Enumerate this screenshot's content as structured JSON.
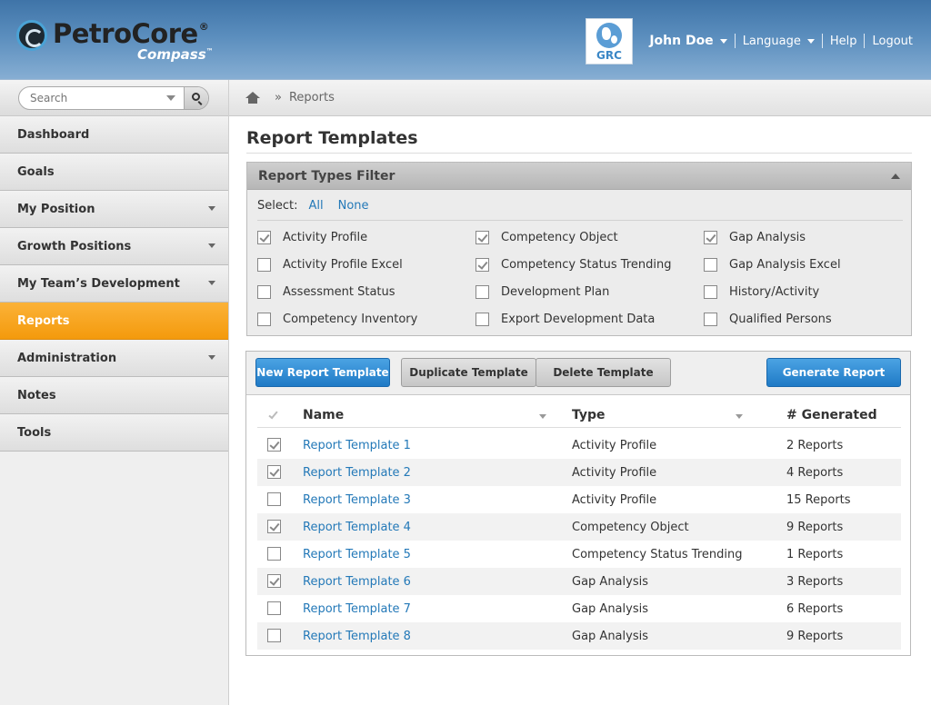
{
  "brand": {
    "name": "PetroCore",
    "reg": "®",
    "sub": "Compass",
    "tm": "™",
    "badge": "GRC"
  },
  "topnav": {
    "user": "John Doe",
    "language": "Language",
    "help": "Help",
    "logout": "Logout"
  },
  "search": {
    "placeholder": "Search"
  },
  "sidebar": {
    "items": [
      {
        "label": "Dashboard"
      },
      {
        "label": "Goals"
      },
      {
        "label": "My Position"
      },
      {
        "label": "Growth Positions"
      },
      {
        "label": "My Team’s Development"
      },
      {
        "label": "Reports"
      },
      {
        "label": "Administration"
      },
      {
        "label": "Notes"
      },
      {
        "label": "Tools"
      }
    ]
  },
  "breadcrumb": {
    "current": "Reports",
    "separator": "»"
  },
  "page": {
    "title": "Report Templates"
  },
  "filter": {
    "title": "Report Types Filter",
    "select_label": "Select:",
    "all": "All",
    "none": "None",
    "options": [
      {
        "label": "Activity Profile",
        "checked": true
      },
      {
        "label": "Activity Profile Excel",
        "checked": false
      },
      {
        "label": "Assessment Status",
        "checked": false
      },
      {
        "label": "Competency Inventory",
        "checked": false
      },
      {
        "label": "Competency Object",
        "checked": true
      },
      {
        "label": "Competency Status Trending",
        "checked": true
      },
      {
        "label": "Development Plan",
        "checked": false
      },
      {
        "label": "Export Development Data",
        "checked": false
      },
      {
        "label": "Gap Analysis",
        "checked": true
      },
      {
        "label": "Gap Analysis Excel",
        "checked": false
      },
      {
        "label": "History/Activity",
        "checked": false
      },
      {
        "label": "Qualified Persons",
        "checked": false
      }
    ]
  },
  "toolbar": {
    "new_label": "New Report Template",
    "duplicate_label": "Duplicate Template",
    "delete_label": "Delete Template",
    "generate_label": "Generate Report"
  },
  "table": {
    "columns": {
      "name": "Name",
      "type": "Type",
      "generated": "# Generated"
    },
    "rows": [
      {
        "name": "Report Template 1",
        "type": "Activity Profile",
        "generated": "2 Reports",
        "checked": true
      },
      {
        "name": "Report Template 2",
        "type": "Activity Profile",
        "generated": "4 Reports",
        "checked": true
      },
      {
        "name": "Report Template 3",
        "type": "Activity Profile",
        "generated": "15 Reports",
        "checked": false
      },
      {
        "name": "Report Template 4",
        "type": "Competency Object",
        "generated": "9 Reports",
        "checked": true
      },
      {
        "name": "Report Template 5",
        "type": "Competency Status Trending",
        "generated": "1 Reports",
        "checked": false
      },
      {
        "name": "Report Template 6",
        "type": "Gap Analysis",
        "generated": "3 Reports",
        "checked": true
      },
      {
        "name": "Report Template 7",
        "type": "Gap Analysis",
        "generated": "6 Reports",
        "checked": false
      },
      {
        "name": "Report Template 8",
        "type": "Gap Analysis",
        "generated": "9 Reports",
        "checked": false
      }
    ]
  }
}
